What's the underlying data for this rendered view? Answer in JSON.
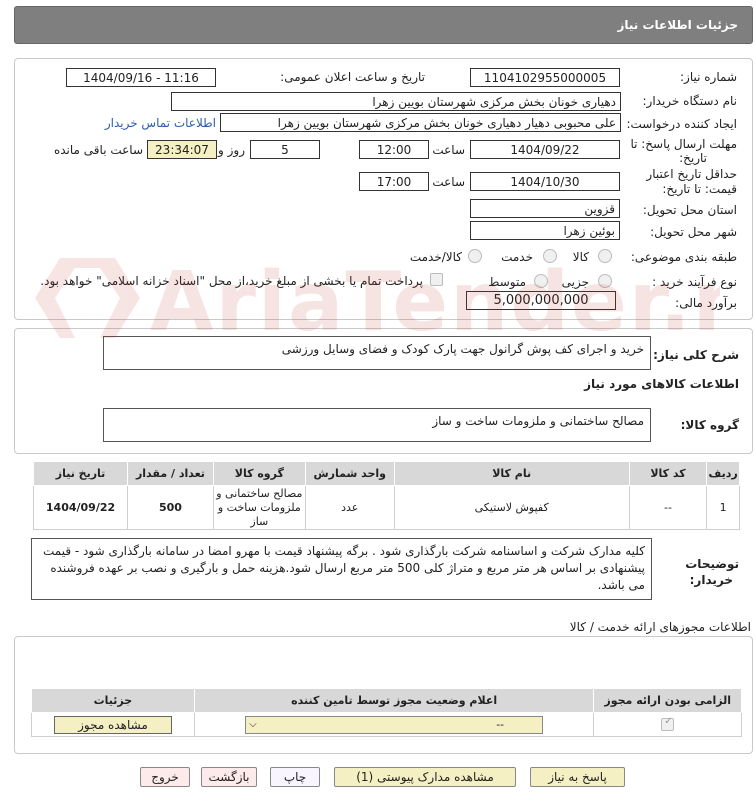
{
  "header": {
    "title": "جزئیات اطلاعات نیاز"
  },
  "form": {
    "need_number_label": "شماره نیاز:",
    "need_number": "1104102955000005",
    "announce_label": "تاریخ و ساعت اعلان عمومی:",
    "announce_value": "1404/09/16 - 11:16",
    "buyer_org_label": "نام دستگاه خریدار:",
    "buyer_org": "دهیاری خونان بخش مرکزی شهرستان بویین زهرا",
    "creator_label": "ایجاد کننده درخواست:",
    "creator": "علی محبوبی دهیار دهیاری خونان بخش مرکزی شهرستان بویین زهرا",
    "contact_link": "اطلاعات تماس خریدار",
    "deadline_label_1": "مهلت ارسال پاسخ: تا",
    "deadline_label_2": "تاریخ:",
    "deadline_date": "1404/09/22",
    "time_label": "ساعت",
    "deadline_time": "12:00",
    "days_value": "5",
    "days_label": "روز و",
    "remaining_time": "23:34:07",
    "remaining_label": "ساعت باقی مانده",
    "validity_label_1": "حداقل تاریخ اعتبار",
    "validity_label_2": "قیمت: تا تاریخ:",
    "validity_date": "1404/10/30",
    "validity_time": "17:00",
    "province_label": "استان محل تحویل:",
    "province": "قزوین",
    "city_label": "شهر محل تحویل:",
    "city": "بوئین زهرا",
    "category_label": "طبقه بندی موضوعی:",
    "category_options": [
      "کالا",
      "خدمت",
      "کالا/خدمت"
    ],
    "process_label": "نوع فرآیند خرید :",
    "process_options": [
      "جزیی",
      "متوسط"
    ],
    "payment_note": "پرداخت تمام یا بخشی از مبلغ خرید،از محل \"اسناد خزانه اسلامی\" خواهد بود.",
    "budget_label": "برآورد مالی:",
    "budget": "5,000,000,000"
  },
  "description": {
    "label": "شرح کلی نیاز:",
    "text": "خرید و اجرای کف پوش گرانول جهت پارک کودک و فضای وسایل ورزشی"
  },
  "goods": {
    "section_title": "اطلاعات کالاهای مورد نیاز",
    "group_label": "گروه کالا:",
    "group_value": "مصالح ساختمانی و ملزومات ساخت و ساز",
    "columns": [
      "ردیف",
      "کد کالا",
      "نام کالا",
      "واحد شمارش",
      "گروه کالا",
      "تعداد / مقدار",
      "تاریخ نیاز"
    ],
    "rows": [
      {
        "row": "1",
        "code": "--",
        "name": "کفپوش لاستیکی",
        "unit": "عدد",
        "group": "مصالح ساختمانی و ملزومات ساخت و ساز",
        "qty": "500",
        "date": "1404/09/22"
      }
    ]
  },
  "buyer_notes": {
    "label_1": "توضیحات",
    "label_2": "خریدار:",
    "text": "کلیه مدارک شرکت و اساسنامه شرکت بارگذاری شود . برگه پیشنهاد قیمت با مهرو امضا در سامانه بارگذاری شود - قیمت پیشنهادی بر اساس هر متر مربع و متراژ کلی 500 متر مربع ارسال شود.هزینه حمل و بارگیری و نصب بر عهده فروشنده می باشد."
  },
  "permits": {
    "section_title": "اطلاعات مجوزهای ارائه خدمت / کالا",
    "columns": [
      "الزامی بودن ارائه مجوز",
      "اعلام وضعیت مجوز توسط تامین کننده",
      "جزئیات"
    ],
    "select_value": "--",
    "view_button": "مشاهده مجوز"
  },
  "buttons": {
    "reply": "پاسخ به نیاز",
    "attachments": "مشاهده مدارک پیوستی (1)",
    "print": "چاپ",
    "back": "بازگشت",
    "exit": "خروج"
  },
  "watermark": {
    "text": "AriaTender.neT"
  },
  "colors": {
    "header_bg": "#7f7f7f",
    "remaining_bg": "#f4f0c4",
    "link": "#2a5db0",
    "table_header": "#d8d8d8"
  }
}
